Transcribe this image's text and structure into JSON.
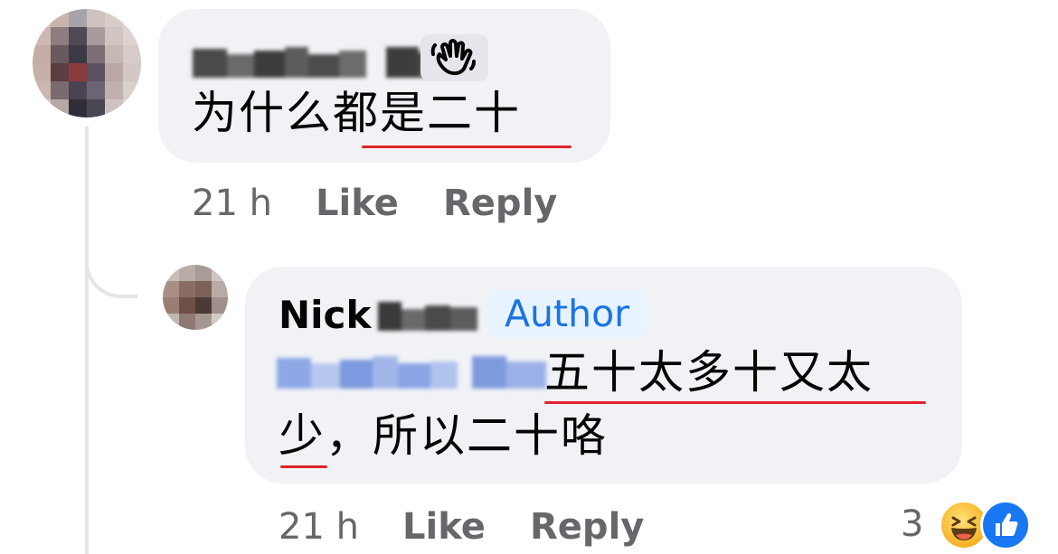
{
  "colors": {
    "bubble": "#f0f2f5",
    "meta_text": "#65676b",
    "author_badge_bg": "#e7f3ff",
    "author_badge_text": "#1b74e4",
    "spellcheck_underline": "#e0232b",
    "like_blue": "#1877f2"
  },
  "comment": {
    "author_name": "Andrin Tan",
    "author_name_blurred": true,
    "badge_icon": "waving-hand-icon",
    "text": "为什么都是二十",
    "time": "21 h",
    "like_label": "Like",
    "reply_label": "Reply"
  },
  "reply": {
    "author_first_name": "Nick",
    "author_last_name_blurred": true,
    "author_badge": "Author",
    "mention_blurred": true,
    "text_line1": "五十太多十又太",
    "text_line2": "少，所以二十咯",
    "time": "21 h",
    "like_label": "Like",
    "reply_label": "Reply",
    "reaction_count": "3",
    "reaction_icons": [
      "haha-icon",
      "like-icon"
    ]
  }
}
